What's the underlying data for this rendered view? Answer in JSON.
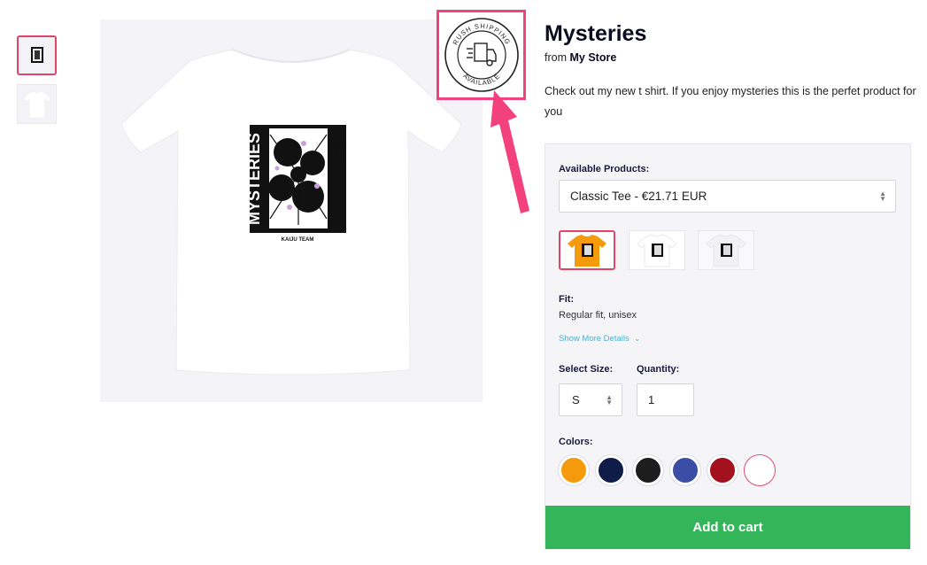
{
  "product": {
    "title": "Mysteries",
    "from_prefix": "from",
    "store_name": "My Store",
    "description": "Check out my new t shirt. If you enjoy mysteries this is the perfet product for you"
  },
  "shirt_print": {
    "side_text": "MYSTERIES",
    "kana_text": "ぱたぱた",
    "brand_text": "KAIJU TEAM"
  },
  "badge": {
    "line_top": "RUSH SHIPPING",
    "line_bottom": "AVAILABLE",
    "icon": "delivery-truck-icon",
    "highlight_color": "#f2417d"
  },
  "options": {
    "products_label": "Available Products:",
    "selected_product": "Classic Tee - €21.71 EUR",
    "fit_label": "Fit:",
    "fit_value": "Regular fit, unisex",
    "more_details": "Show More Details",
    "size_label": "Select Size:",
    "size_value": "S",
    "quantity_label": "Quantity:",
    "quantity_value": "1",
    "colors_label": "Colors:",
    "colors": [
      "#f59a0d",
      "#0f1c48",
      "#1d1d1d",
      "#3b4ea6",
      "#a3101e",
      "#ffffff"
    ],
    "selected_color_index": 5
  },
  "cart": {
    "button_label": "Add to cart",
    "button_color": "#35b55a"
  },
  "accent_color": "#e0446b"
}
